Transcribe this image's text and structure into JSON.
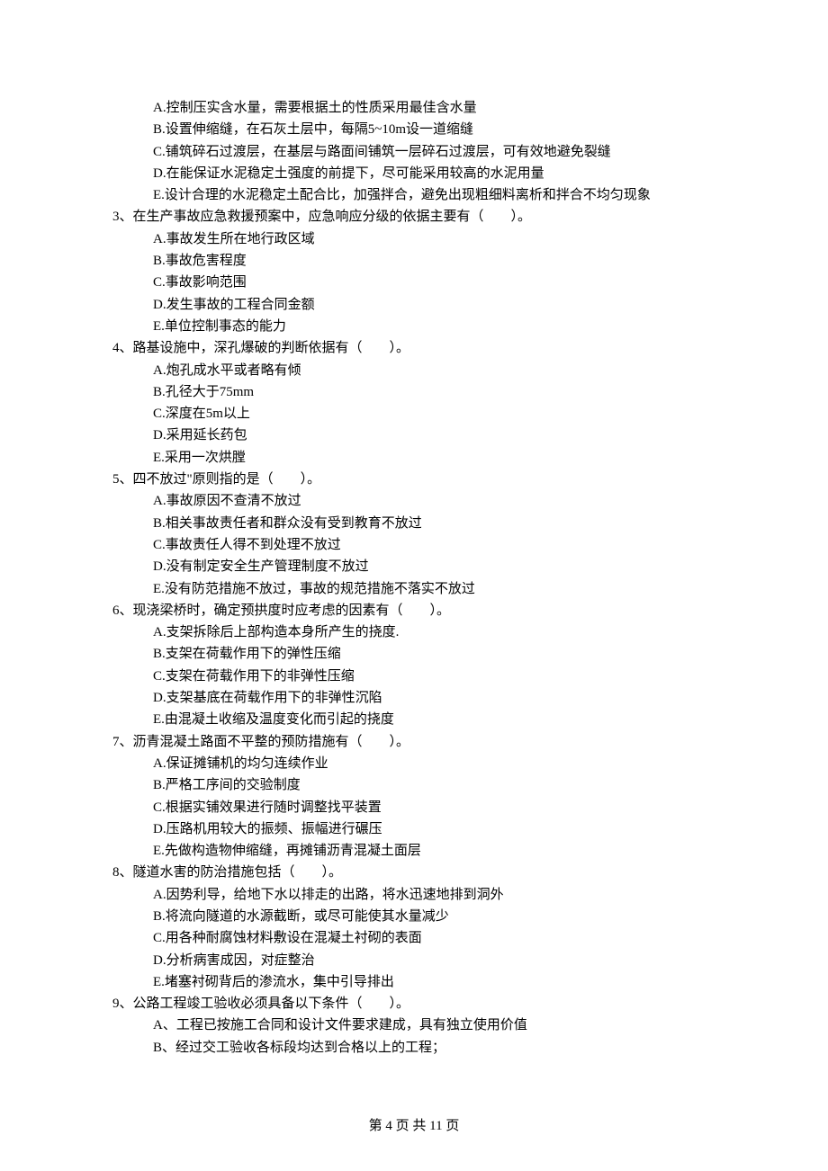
{
  "pre_options": [
    "A.控制压实含水量，需要根据土的性质采用最佳含水量",
    "B.设置伸缩缝，在石灰土层中，每隔5~10m设一道缩缝",
    "C.铺筑碎石过渡层，在基层与路面间铺筑一层碎石过渡层，可有效地避免裂缝",
    "D.在能保证水泥稳定土强度的前提下，尽可能采用较高的水泥用量",
    "E.设计合理的水泥稳定土配合比，加强拌合，避免出现粗细料离析和拌合不均匀现象"
  ],
  "questions": [
    {
      "q": "3、在生产事故应急救援预案中，应急响应分级的依据主要有（　　）。",
      "opts": [
        "A.事故发生所在地行政区域",
        "B.事故危害程度",
        "C.事故影响范围",
        "D.发生事故的工程合同金额",
        "E.单位控制事态的能力"
      ]
    },
    {
      "q": "4、路基设施中，深孔爆破的判断依据有（　　）。",
      "opts": [
        "A.炮孔成水平或者略有倾",
        "B.孔径大于75mm",
        "C.深度在5m以上",
        "D.采用延长药包",
        "E.采用一次烘膛"
      ]
    },
    {
      "q": "5、四不放过\"原则指的是（　　）。",
      "opts": [
        "A.事故原因不查清不放过",
        "B.相关事故责任者和群众没有受到教育不放过",
        "C.事故责任人得不到处理不放过",
        "D.没有制定安全生产管理制度不放过",
        "E.没有防范措施不放过，事故的规范措施不落实不放过"
      ]
    },
    {
      "q": "6、现浇梁桥时，确定预拱度时应考虑的因素有（　　）。",
      "opts": [
        "A.支架拆除后上部构造本身所产生的挠度.",
        "B.支架在荷载作用下的弹性压缩",
        "C.支架在荷载作用下的非弹性压缩",
        "D.支架基底在荷载作用下的非弹性沉陷",
        "E.由混凝土收缩及温度变化而引起的挠度"
      ]
    },
    {
      "q": "7、沥青混凝土路面不平整的预防措施有（　　）。",
      "opts": [
        "A.保证摊铺机的均匀连续作业",
        "B.严格工序间的交验制度",
        "C.根据实铺效果进行随时调整找平装置",
        "D.压路机用较大的振频、振幅进行碾压",
        "E.先做构造物伸缩缝，再摊铺沥青混凝土面层"
      ]
    },
    {
      "q": "8、隧道水害的防治措施包括（　　）。",
      "opts": [
        "A.因势利导，给地下水以排走的出路，将水迅速地排到洞外",
        "B.将流向隧道的水源截断，或尽可能使其水量减少",
        "C.用各种耐腐蚀材料敷设在混凝土衬砌的表面",
        "D.分析病害成因，对症整治",
        "E.堵塞衬砌背后的渗流水，集中引导排出"
      ]
    },
    {
      "q": "9、公路工程竣工验收必须具备以下条件（　　）。",
      "opts": [
        "A、工程已按施工合同和设计文件要求建成，具有独立使用价值",
        "B、经过交工验收各标段均达到合格以上的工程；"
      ]
    }
  ],
  "footer": "第 4 页 共 11 页"
}
